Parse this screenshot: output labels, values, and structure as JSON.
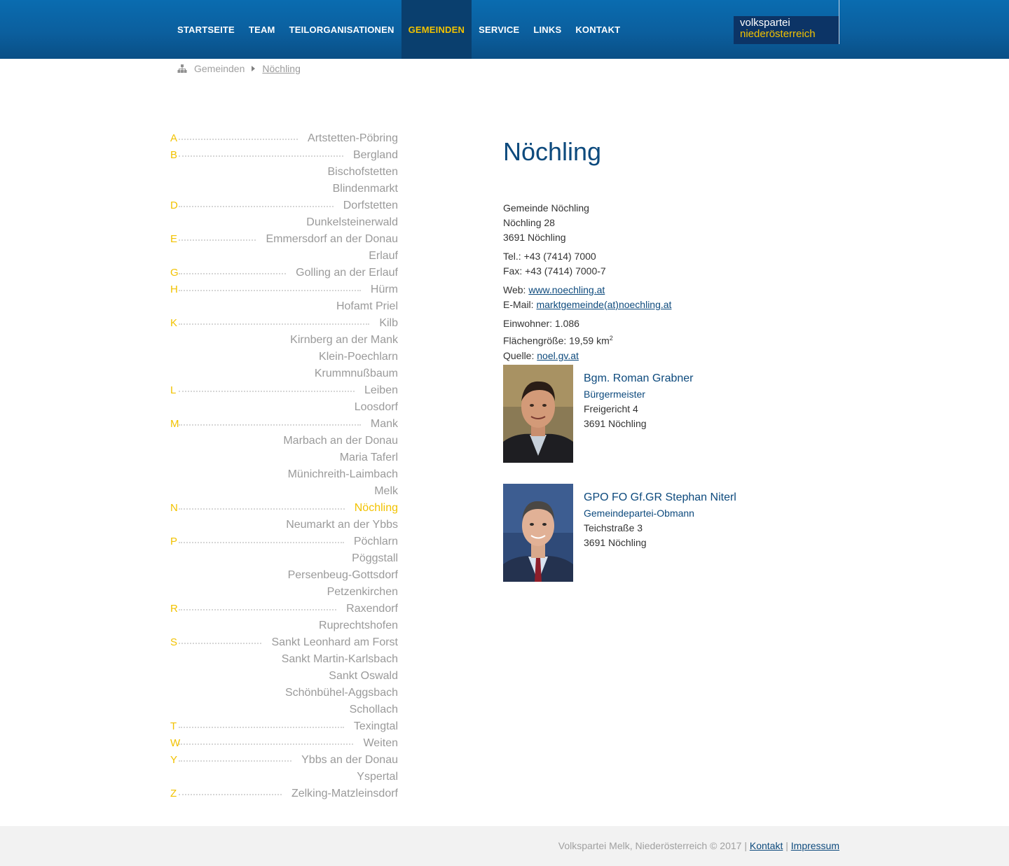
{
  "nav": {
    "items": [
      {
        "label": "STARTSEITE",
        "active": false
      },
      {
        "label": "TEAM",
        "active": false
      },
      {
        "label": "TEILORGANISATIONEN",
        "active": false
      },
      {
        "label": "GEMEINDEN",
        "active": true
      },
      {
        "label": "SERVICE",
        "active": false
      },
      {
        "label": "LINKS",
        "active": false
      },
      {
        "label": "KONTAKT",
        "active": false
      }
    ]
  },
  "logo": {
    "line1": "volkspartei",
    "line2": "niederösterreich"
  },
  "breadcrumb": {
    "parent": "Gemeinden",
    "current": "Nöchling"
  },
  "gemeinden": [
    {
      "letter": "A",
      "name": "Artstetten-Pöbring"
    },
    {
      "letter": "B",
      "name": "Bergland"
    },
    {
      "letter": "",
      "name": "Bischofstetten"
    },
    {
      "letter": "",
      "name": "Blindenmarkt"
    },
    {
      "letter": "D",
      "name": "Dorfstetten"
    },
    {
      "letter": "",
      "name": "Dunkelsteinerwald"
    },
    {
      "letter": "E",
      "name": "Emmersdorf an der Donau"
    },
    {
      "letter": "",
      "name": "Erlauf"
    },
    {
      "letter": "G",
      "name": "Golling an der Erlauf"
    },
    {
      "letter": "H",
      "name": "Hürm"
    },
    {
      "letter": "",
      "name": "Hofamt Priel"
    },
    {
      "letter": "K",
      "name": "Kilb"
    },
    {
      "letter": "",
      "name": "Kirnberg an der Mank"
    },
    {
      "letter": "",
      "name": "Klein-Poechlarn"
    },
    {
      "letter": "",
      "name": "Krummnußbaum"
    },
    {
      "letter": "L",
      "name": "Leiben"
    },
    {
      "letter": "",
      "name": "Loosdorf"
    },
    {
      "letter": "M",
      "name": "Mank"
    },
    {
      "letter": "",
      "name": "Marbach an der Donau"
    },
    {
      "letter": "",
      "name": "Maria Taferl"
    },
    {
      "letter": "",
      "name": "Münichreith-Laimbach"
    },
    {
      "letter": "",
      "name": "Melk"
    },
    {
      "letter": "N",
      "name": "Nöchling",
      "active": true
    },
    {
      "letter": "",
      "name": "Neumarkt an der Ybbs"
    },
    {
      "letter": "P",
      "name": "Pöchlarn"
    },
    {
      "letter": "",
      "name": "Pöggstall"
    },
    {
      "letter": "",
      "name": "Persenbeug-Gottsdorf"
    },
    {
      "letter": "",
      "name": "Petzenkirchen"
    },
    {
      "letter": "R",
      "name": "Raxendorf"
    },
    {
      "letter": "",
      "name": "Ruprechtshofen"
    },
    {
      "letter": "S",
      "name": "Sankt Leonhard am Forst"
    },
    {
      "letter": "",
      "name": "Sankt Martin-Karlsbach"
    },
    {
      "letter": "",
      "name": "Sankt Oswald"
    },
    {
      "letter": "",
      "name": "Schönbühel-Aggsbach"
    },
    {
      "letter": "",
      "name": "Schollach"
    },
    {
      "letter": "T",
      "name": "Texingtal"
    },
    {
      "letter": "W",
      "name": "Weiten"
    },
    {
      "letter": "Y",
      "name": "Ybbs an der Donau"
    },
    {
      "letter": "",
      "name": "Ysper­tal"
    },
    {
      "letter": "Z",
      "name": "Zelking-Matzleinsdorf"
    }
  ],
  "detail": {
    "title": "Nöchling",
    "address1": "Gemeinde Nöchling",
    "address2": "Nöchling 28",
    "address3": "3691 Nöchling",
    "tel": "Tel.: +43 (7414) 7000",
    "fax": "Fax: +43 (7414) 7000-7",
    "web_label": "Web: ",
    "web": "www.noechling.at ",
    "email_label": "E-Mail: ",
    "email": "marktgemeinde(at)noechling.at",
    "einwohner": "Einwohner: 1.086",
    "flaeche": "Flächengröße: 19,59 km",
    "flaeche_sup": "2",
    "quelle_label": "Quelle: ",
    "quelle": "noel.gv.at"
  },
  "people": [
    {
      "name": "Bgm. Roman Grabner",
      "role": "Bürgermeister",
      "street": "Freigericht 4",
      "city": "3691 Nöchling"
    },
    {
      "name": "GPO FO Gf.GR Stephan Niterl",
      "role": "Gemeindepartei-Obmann",
      "street": "Teichstraße 3",
      "city": "3691 Nöchling"
    }
  ],
  "footer": {
    "text": "Volkspartei Melk, Niederösterreich © 2017 | ",
    "kontakt": "Kontakt",
    "sep": " | ",
    "impressum": "Impressum"
  },
  "colors": {
    "accent": "#f2c200",
    "brand": "#0d4a7d",
    "nav_bg": "#0b5f9e",
    "nav_active": "#0a3f6e"
  }
}
